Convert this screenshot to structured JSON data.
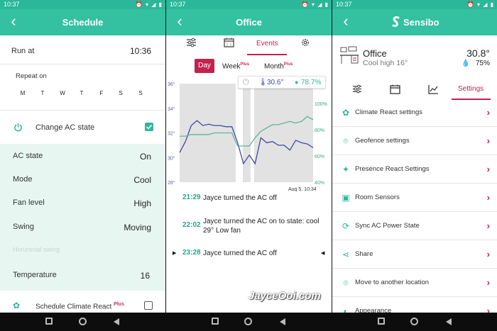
{
  "status_time": "10:37",
  "schedule": {
    "title": "Schedule",
    "run_at_label": "Run at",
    "run_at_value": "10:36",
    "repeat_label": "Repeat on",
    "days": [
      "M",
      "T",
      "W",
      "T",
      "F",
      "S",
      "S"
    ],
    "change_ac_label": "Change AC state",
    "ac_state_label": "AC state",
    "ac_state_value": "On",
    "mode_label": "Mode",
    "mode_value": "Cool",
    "fan_label": "Fan level",
    "fan_value": "High",
    "swing_label": "Swing",
    "swing_value": "Moving",
    "hswing_label": "Horizontal swing",
    "temp_label": "Temperature",
    "temp_value": "16",
    "climate_label": "Schedule Climate React",
    "plus": "Plus"
  },
  "office": {
    "title": "Office",
    "events_tab": "Events",
    "range_day": "Day",
    "range_week": "Week",
    "range_month": "Month",
    "plus": "Plus",
    "temp_readout": "30.6°",
    "humidity_readout": "78.7%",
    "chart_time": "Aug 5, 10:34",
    "events": [
      {
        "time": "21:29",
        "text": "Jayce turned the AC off"
      },
      {
        "time": "22:02",
        "text": "Jayce turned the AC on to state: cool 29° Low fan"
      },
      {
        "time": "23:28",
        "text": "Jayce turned the AC off"
      }
    ]
  },
  "chart_data": {
    "type": "line",
    "y_left_ticks": [
      "36°",
      "34°",
      "32°",
      "30°",
      "28°"
    ],
    "y_right_ticks": [
      "100%",
      "80%",
      "60%",
      "40%"
    ],
    "ylim_left": [
      28,
      36
    ],
    "ylim_right": [
      40,
      100
    ],
    "series": [
      {
        "axis": "left",
        "color": "#3f4aa3",
        "values": [
          30.4,
          31.3,
          32.6,
          33.0,
          32.6,
          32.7,
          32.6,
          32.6,
          32.5,
          32.5,
          31.2,
          29.5,
          30.2,
          29.5,
          31.6,
          31.2,
          31.3,
          31.0,
          31.0,
          30.6,
          31.4,
          31.2,
          31.1,
          30.8
        ]
      },
      {
        "axis": "right",
        "color": "#5fb59b",
        "values": [
          68,
          68,
          69,
          69,
          69,
          69,
          70,
          70,
          70,
          70,
          62,
          62,
          62,
          67,
          71,
          73,
          75,
          75,
          76,
          77,
          76,
          77,
          80,
          78
        ]
      }
    ]
  },
  "sensibo": {
    "brand": "Sensibo",
    "room_name": "Office",
    "room_state": "Cool high 16°",
    "room_temp": "30.8°",
    "room_humidity": "75%",
    "settings_tab": "Settings",
    "items": [
      {
        "label": "Climate React settings",
        "icon": "climate-react-icon"
      },
      {
        "label": "Geofence settings",
        "icon": "location-pin-icon"
      },
      {
        "label": "Presence React Settings",
        "icon": "presence-icon"
      },
      {
        "label": "Room Sensors",
        "icon": "sensor-icon"
      },
      {
        "label": "Sync AC Power State",
        "icon": "sync-icon"
      },
      {
        "label": "Share",
        "icon": "share-icon"
      },
      {
        "label": "Move to another location",
        "icon": "move-location-icon"
      },
      {
        "label": "Appearance",
        "icon": "appearance-icon"
      }
    ]
  },
  "watermark": "JayceOoi.com",
  "colors": {
    "teal": "#33c1a2",
    "accent": "#c2224f",
    "light_teal": "#e8f6f2"
  }
}
